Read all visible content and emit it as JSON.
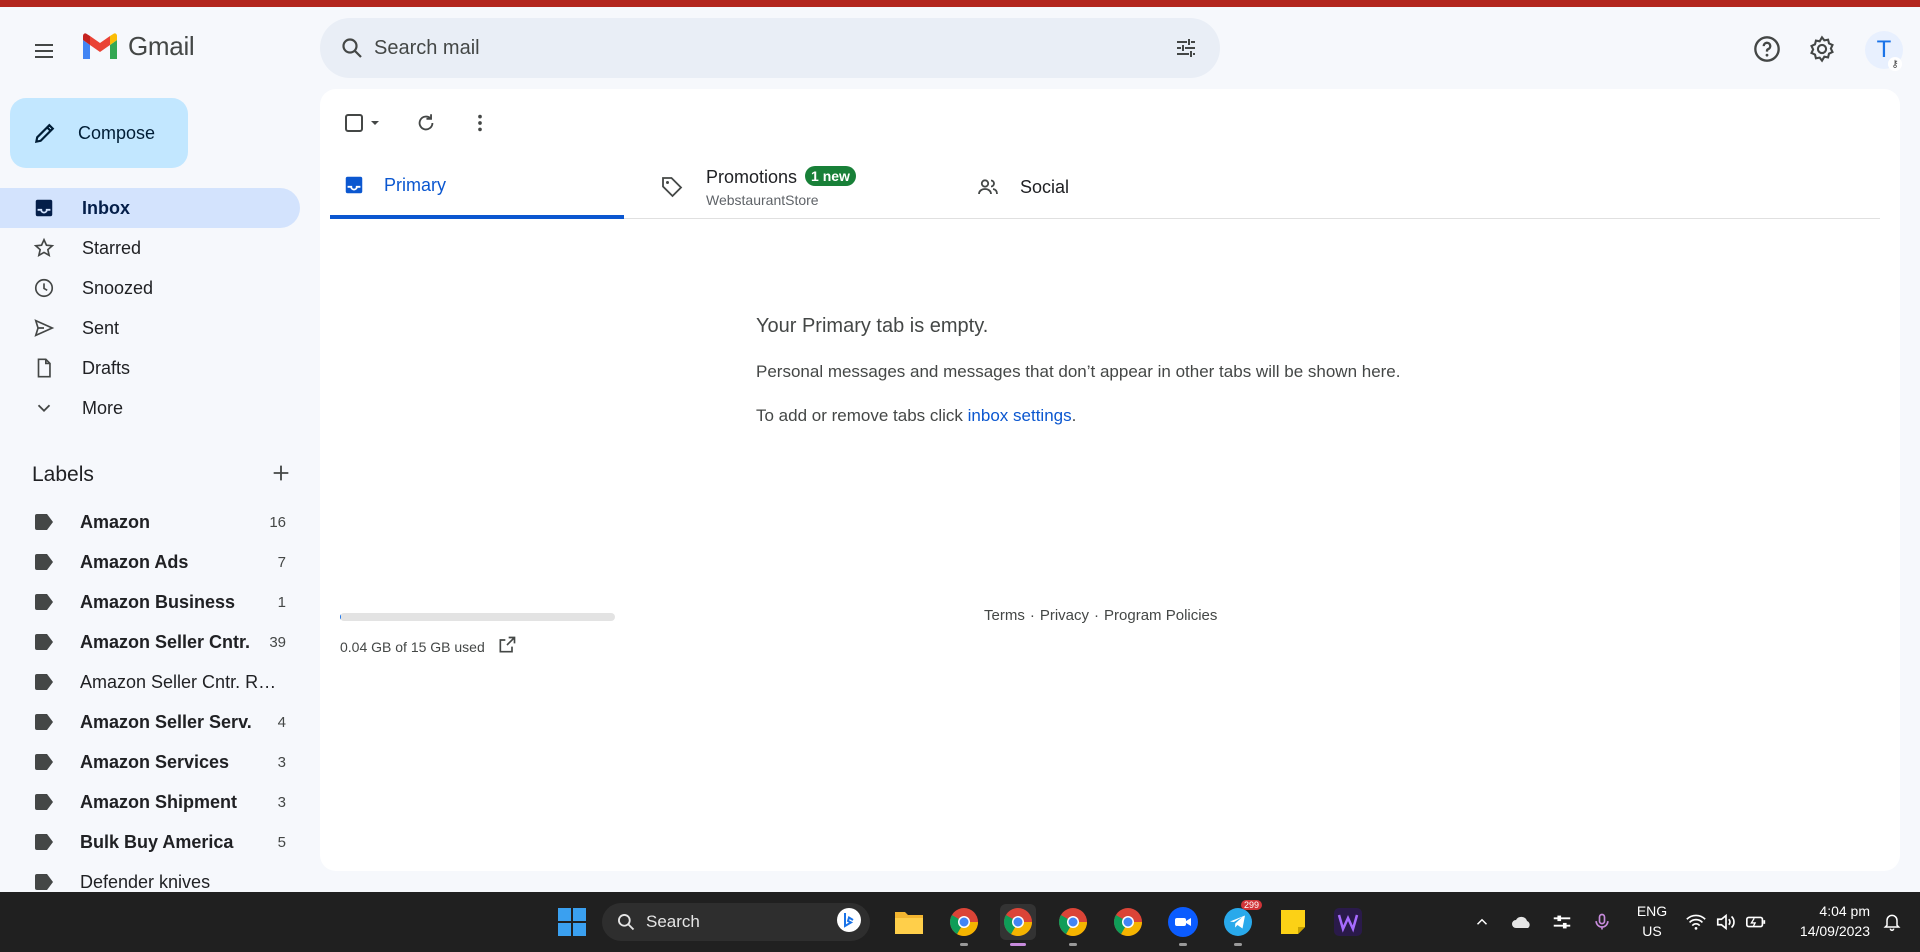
{
  "app": {
    "name": "Gmail"
  },
  "search": {
    "placeholder": "Search mail"
  },
  "header": {
    "avatar_letter": "T"
  },
  "compose": {
    "label": "Compose"
  },
  "nav": [
    {
      "label": "Inbox",
      "icon": "inbox-icon",
      "active": true
    },
    {
      "label": "Starred",
      "icon": "star-icon"
    },
    {
      "label": "Snoozed",
      "icon": "clock-icon"
    },
    {
      "label": "Sent",
      "icon": "send-icon"
    },
    {
      "label": "Drafts",
      "icon": "draft-icon"
    },
    {
      "label": "More",
      "icon": "chevron-down-icon"
    }
  ],
  "labels": {
    "title": "Labels",
    "items": [
      {
        "name": "Amazon",
        "count": "16",
        "bold": true
      },
      {
        "name": "Amazon Ads",
        "count": "7",
        "bold": true
      },
      {
        "name": "Amazon Business",
        "count": "1",
        "bold": true
      },
      {
        "name": "Amazon Seller Cntr.",
        "count": "39",
        "bold": true
      },
      {
        "name": "Amazon Seller Cntr. Ref...",
        "count": "",
        "bold": false
      },
      {
        "name": "Amazon Seller Serv.",
        "count": "4",
        "bold": true
      },
      {
        "name": "Amazon Services",
        "count": "3",
        "bold": true
      },
      {
        "name": "Amazon Shipment",
        "count": "3",
        "bold": true
      },
      {
        "name": "Bulk Buy America",
        "count": "5",
        "bold": true
      },
      {
        "name": "Defender knives",
        "count": "",
        "bold": false
      }
    ]
  },
  "tabs": {
    "primary": "Primary",
    "promotions": {
      "label": "Promotions",
      "badge": "1 new",
      "sub": "WebstaurantStore"
    },
    "social": "Social"
  },
  "empty": {
    "title": "Your Primary tab is empty.",
    "line1": "Personal messages and messages that don’t appear in other tabs will be shown here.",
    "line2_prefix": "To add or remove tabs click ",
    "line2_link": "inbox settings",
    "line2_suffix": "."
  },
  "storage": {
    "text": "0.04 GB of 15 GB used",
    "fraction": 0.003
  },
  "footer": {
    "terms": "Terms",
    "sep": "·",
    "privacy": "Privacy",
    "policies": "Program Policies"
  },
  "taskbar": {
    "search": "Search",
    "telegram_badge": "299",
    "lang1": "ENG",
    "lang2": "US",
    "time": "4:04 pm",
    "date": "14/09/2023"
  },
  "colors": {
    "accent": "#0b57d0",
    "compose_bg": "#c2e7ff",
    "active_nav": "#d3e3fd",
    "badge_green": "#188038",
    "top_stripe": "#b3261e"
  }
}
